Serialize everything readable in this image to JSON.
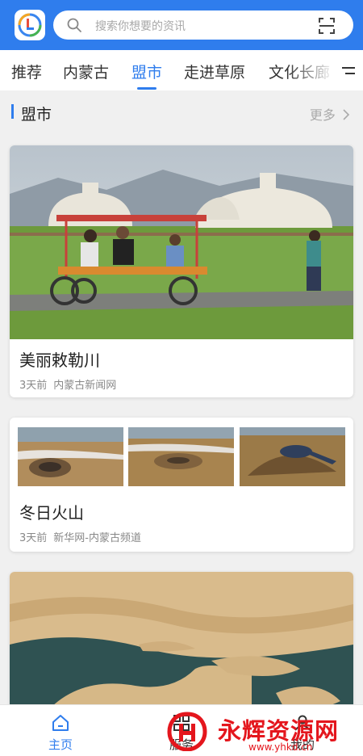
{
  "header": {
    "search_placeholder": "搜索你想要的资讯"
  },
  "tabs": [
    {
      "label": "推荐"
    },
    {
      "label": "内蒙古"
    },
    {
      "label": "盟市"
    },
    {
      "label": "走进草原"
    },
    {
      "label": "文化长廊"
    }
  ],
  "active_tab": "盟市",
  "section": {
    "title": "盟市",
    "more": "更多"
  },
  "articles": [
    {
      "title": "美丽敕勒川",
      "time": "3天前",
      "source": "内蒙古新闻网"
    },
    {
      "title": "冬日火山",
      "time": "3天前",
      "source": "新华网-内蒙古频道"
    }
  ],
  "bottom_nav": [
    {
      "label": "主页"
    },
    {
      "label": "服务"
    },
    {
      "label": "我的"
    }
  ],
  "watermark": {
    "text": "永辉资源网",
    "url": "www.yhkd.cn"
  },
  "colors": {
    "primary": "#2f7ded",
    "watermark": "#e4161d"
  }
}
